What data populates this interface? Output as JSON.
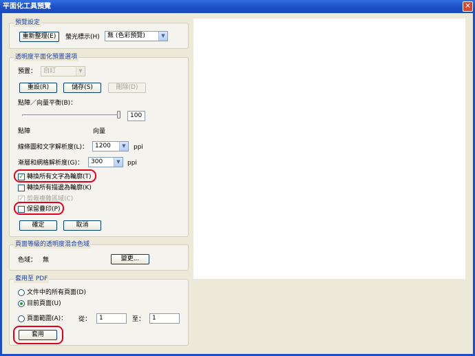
{
  "window": {
    "title": "平面化工具預覽",
    "close_glyph": "✕"
  },
  "preview_settings": {
    "title": "預覽設定",
    "refresh_label": "重新整理(E)",
    "highlight_label": "螢光標示(H)",
    "highlight_value": "無 (色彩預覽)"
  },
  "transparency": {
    "title": "透明度平面化預置選項",
    "preset_label": "預置：",
    "preset_value": "自訂",
    "reset_label": "重設(R)",
    "save_label": "儲存(S)",
    "delete_label": "刪除(D)",
    "balance_label": "點陣／向量平衡(B)：",
    "balance_value": "100",
    "raster_label": "點陣",
    "vector_label": "向量",
    "line_art_label": "線條圖和文字解析度(L)：",
    "line_art_value": "1200",
    "unit_ppi_1": "ppi",
    "gradient_label": "漸層和網格解析度(G)：",
    "gradient_value": "300",
    "unit_ppi_2": "ppi",
    "convert_text_label": "轉換所有文字為輪廓(T)",
    "convert_text_checked": true,
    "convert_strokes_label": "轉換所有描邊為輪廓(K)",
    "convert_strokes_checked": false,
    "clip_complex_label": "剪裁複雜區域(C)",
    "clip_complex_checked": true,
    "preserve_overprint_label": "保留疊印(P)",
    "preserve_overprint_checked": false,
    "ok_label": "確定",
    "cancel_label": "取消",
    "check_glyph": "✓"
  },
  "page_level": {
    "title": "頁面等級的透明度混合色域",
    "color_space_label": "色域：",
    "color_space_value": "無",
    "change_label": "變更..."
  },
  "apply_to_pdf": {
    "title": "套用至 PDF",
    "all_pages_label": "文件中的所有頁面(D)",
    "current_page_label": "目前頁面(U)",
    "page_range_label": "頁面範圍(A)：",
    "selected": "current_page",
    "from_label": "從：",
    "from_value": "1",
    "to_label": "至：",
    "to_value": "1",
    "apply_label": "套用"
  },
  "colors": {
    "accent": "#1f42a8",
    "highlight_ring": "#e0001b",
    "title_bar": "#1c4fc7"
  }
}
